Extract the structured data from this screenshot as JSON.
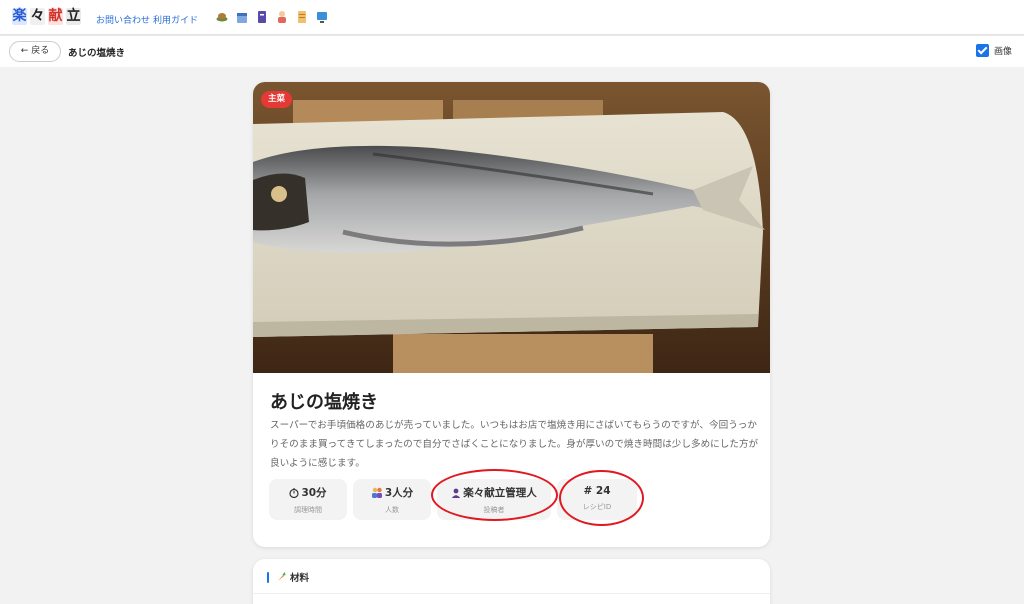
{
  "header": {
    "logo_chars": [
      "楽",
      "々",
      "献",
      "立"
    ],
    "links": [
      "お問い合わせ",
      "利用ガイド"
    ],
    "icons": [
      "dish-icon",
      "calendar-icon",
      "book-icon",
      "cook-icon",
      "scroll-icon",
      "monitor-icon"
    ]
  },
  "subbar": {
    "back_label": "← 戻る",
    "title": "あじの塩焼き",
    "image_toggle_label": "画像",
    "image_toggle_checked": true
  },
  "recipe": {
    "badge": "主菜",
    "title": "あじの塩焼き",
    "description": "スーパーでお手頃価格のあじが売っていました。いつもはお店で塩焼き用にさばいてもらうのですが、今回うっかりそのまま買ってきてしまったので自分でさばくことになりました。身が厚いので焼き時間は少し多めにした方が良いように感じます。",
    "stats": [
      {
        "icon": "timer-icon",
        "value": "30分",
        "label": "調理時間"
      },
      {
        "icon": "people-icon",
        "value": "3人分",
        "label": "人数"
      },
      {
        "icon": "person-icon",
        "value": "楽々献立管理人",
        "label": "投稿者"
      },
      {
        "icon": "",
        "value": "# 24",
        "label": "レシピID"
      }
    ]
  },
  "materials": {
    "heading": "材料",
    "icon": "carrot-icon"
  },
  "colors": {
    "accent": "#1a73e8",
    "badge": "#e53935",
    "annotation": "#e0181f"
  }
}
